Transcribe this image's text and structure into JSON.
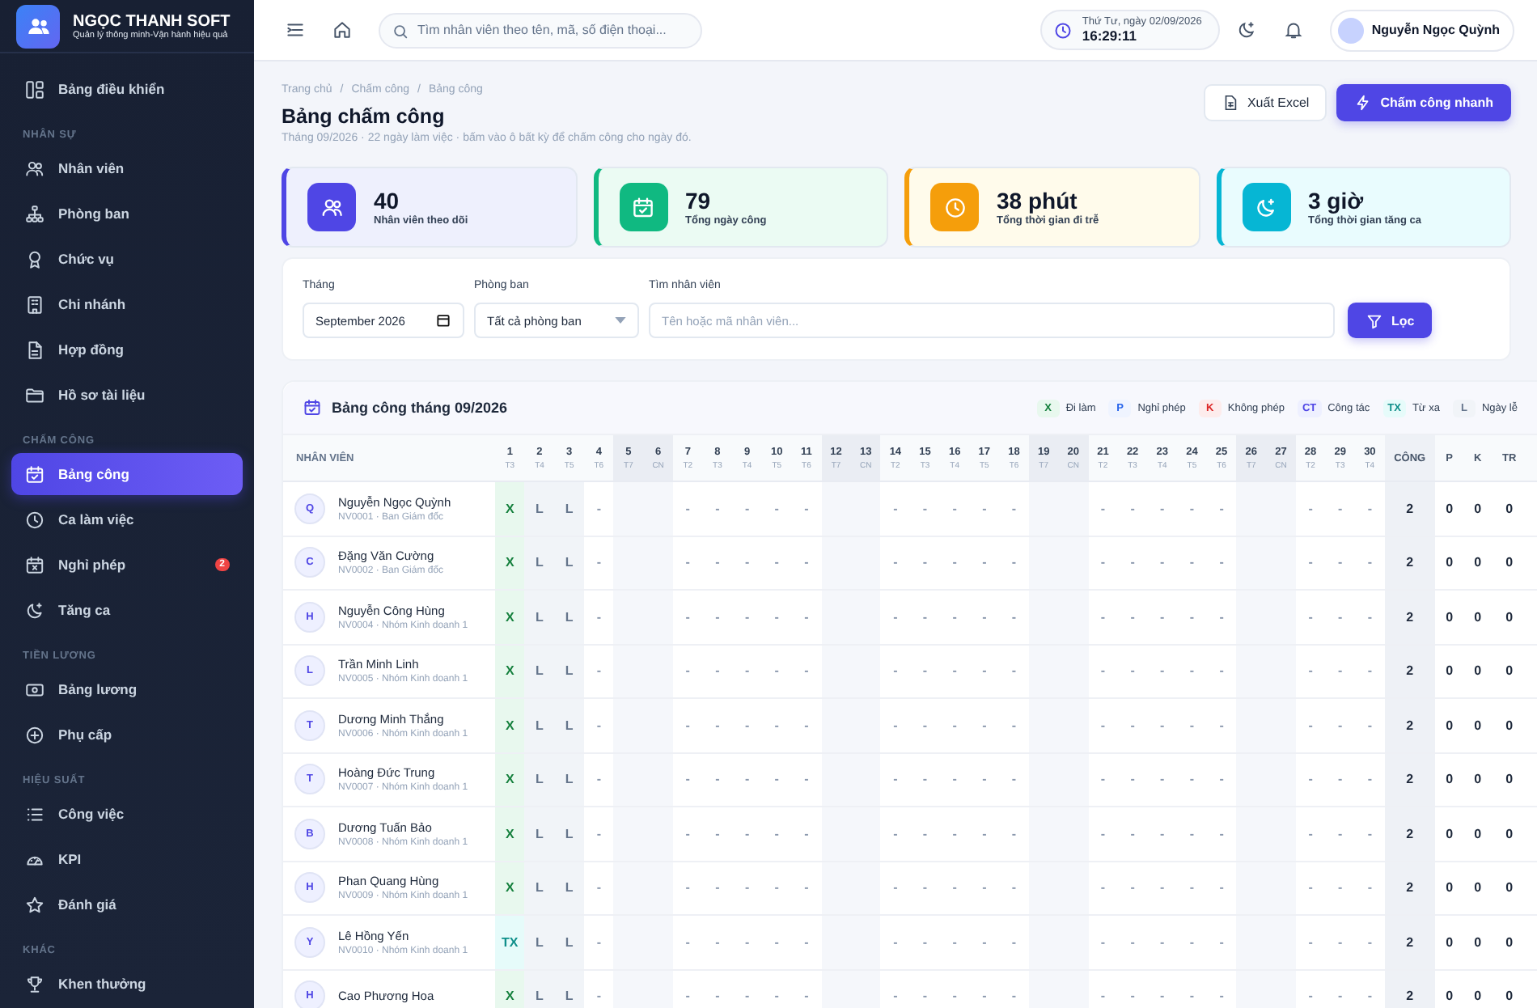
{
  "sidebar": {
    "brand": {
      "name": "NGỌC THANH SOFT",
      "tagline": "Quản lý thông minh-Vận hành hiệu quả"
    },
    "sections": [
      {
        "items": [
          {
            "label": "Bảng điều khiển",
            "selected": false
          }
        ]
      },
      {
        "title": "NHÂN SỰ",
        "items": [
          {
            "label": "Nhân viên",
            "selected": false
          },
          {
            "label": "Phòng ban",
            "selected": false
          },
          {
            "label": "Chức vụ",
            "selected": false
          },
          {
            "label": "Chi nhánh",
            "selected": false
          },
          {
            "label": "Hợp đồng",
            "selected": false
          },
          {
            "label": "Hồ sơ tài liệu",
            "selected": false
          }
        ]
      },
      {
        "title": "CHẤM CÔNG",
        "items": [
          {
            "label": "Bảng công",
            "selected": true
          },
          {
            "label": "Ca làm việc",
            "selected": false
          },
          {
            "label": "Nghỉ phép",
            "selected": false,
            "badge": "2"
          },
          {
            "label": "Tăng ca",
            "selected": false
          }
        ]
      },
      {
        "title": "TIỀN LƯƠNG",
        "items": [
          {
            "label": "Bảng lương",
            "selected": false
          },
          {
            "label": "Phụ cấp",
            "selected": false
          }
        ]
      },
      {
        "title": "HIỆU SUẤT",
        "items": [
          {
            "label": "Công việc",
            "selected": false
          },
          {
            "label": "KPI",
            "selected": false
          },
          {
            "label": "Đánh giá",
            "selected": false
          }
        ]
      },
      {
        "title": "KHÁC",
        "items": [
          {
            "label": "Khen thưởng",
            "selected": false
          }
        ]
      }
    ]
  },
  "topbar": {
    "search": {
      "placeholder": "Tìm nhân viên theo tên, mã, số điện thoại..."
    },
    "clock": {
      "date": "Thứ Tư, ngày 02/09/2026",
      "time": "16:29:11"
    },
    "user": {
      "name": "Nguyễn Ngọc Quỳnh"
    }
  },
  "breadcrumb": {
    "items": [
      "Trang chủ",
      "Chấm công",
      "Bảng công"
    ],
    "separator": "/"
  },
  "page": {
    "title": "Bảng chấm công",
    "subtitle": "Tháng 09/2026 · 22 ngày làm việc · bấm vào ô bất kỳ để chấm công cho ngày đó.",
    "buttons": [
      {
        "label": "Xuất Excel",
        "kind": "secondary"
      },
      {
        "label": "Chấm công nhanh",
        "kind": "primary"
      }
    ]
  },
  "stats": [
    {
      "value": "40",
      "label": "Nhân viên theo dõi",
      "color": "#4f46e5"
    },
    {
      "value": "79",
      "label": "Tổng ngày công",
      "color": "#10b981"
    },
    {
      "value": "38 phút",
      "label": "Tổng thời gian đi trễ",
      "color": "#f59e0b"
    },
    {
      "value": "3 giờ",
      "label": "Tổng thời gian tăng ca",
      "color": "#06b6d4"
    }
  ],
  "filters": {
    "month": {
      "label": "Tháng",
      "value": "September 2026"
    },
    "department": {
      "label": "Phòng ban",
      "value": "Tất cả phòng ban"
    },
    "search": {
      "label": "Tìm nhân viên",
      "placeholder": "Tên hoặc mã nhân viên..."
    },
    "button": "Lọc"
  },
  "table": {
    "title": "Bảng công tháng 09/2026",
    "legend": [
      {
        "code": "X",
        "label": "Đi làm",
        "kind": "present"
      },
      {
        "code": "P",
        "label": "Nghỉ phép",
        "kind": "leave"
      },
      {
        "code": "K",
        "label": "Không phép",
        "kind": "absent"
      },
      {
        "code": "CT",
        "label": "Công tác",
        "kind": "trip"
      },
      {
        "code": "TX",
        "label": "Từ xa",
        "kind": "remote"
      },
      {
        "code": "L",
        "label": "Ngày lễ",
        "kind": "holiday"
      }
    ],
    "name_column": "NHÂN VIÊN",
    "days": [
      {
        "day": "1",
        "weekday": "T3",
        "weekend": false
      },
      {
        "day": "2",
        "weekday": "T4",
        "weekend": false
      },
      {
        "day": "3",
        "weekday": "T5",
        "weekend": false
      },
      {
        "day": "4",
        "weekday": "T6",
        "weekend": false
      },
      {
        "day": "5",
        "weekday": "T7",
        "weekend": true
      },
      {
        "day": "6",
        "weekday": "CN",
        "weekend": true
      },
      {
        "day": "7",
        "weekday": "T2",
        "weekend": false
      },
      {
        "day": "8",
        "weekday": "T3",
        "weekend": false
      },
      {
        "day": "9",
        "weekday": "T4",
        "weekend": false
      },
      {
        "day": "10",
        "weekday": "T5",
        "weekend": false
      },
      {
        "day": "11",
        "weekday": "T6",
        "weekend": false
      },
      {
        "day": "12",
        "weekday": "T7",
        "weekend": true
      },
      {
        "day": "13",
        "weekday": "CN",
        "weekend": true
      },
      {
        "day": "14",
        "weekday": "T2",
        "weekend": false
      },
      {
        "day": "15",
        "weekday": "T3",
        "weekend": false
      },
      {
        "day": "16",
        "weekday": "T4",
        "weekend": false
      },
      {
        "day": "17",
        "weekday": "T5",
        "weekend": false
      },
      {
        "day": "18",
        "weekday": "T6",
        "weekend": false
      },
      {
        "day": "19",
        "weekday": "T7",
        "weekend": true
      },
      {
        "day": "20",
        "weekday": "CN",
        "weekend": true
      },
      {
        "day": "21",
        "weekday": "T2",
        "weekend": false
      },
      {
        "day": "22",
        "weekday": "T3",
        "weekend": false
      },
      {
        "day": "23",
        "weekday": "T4",
        "weekend": false
      },
      {
        "day": "24",
        "weekday": "T5",
        "weekend": false
      },
      {
        "day": "25",
        "weekday": "T6",
        "weekend": false
      },
      {
        "day": "26",
        "weekday": "T7",
        "weekend": true
      },
      {
        "day": "27",
        "weekday": "CN",
        "weekend": true
      },
      {
        "day": "28",
        "weekday": "T2",
        "weekend": false
      },
      {
        "day": "29",
        "weekday": "T3",
        "weekend": false
      },
      {
        "day": "30",
        "weekday": "T4",
        "weekend": false
      }
    ],
    "total_columns": [
      "CÔNG",
      "P",
      "K",
      "TR"
    ],
    "rows": [
      {
        "initial": "Q",
        "name": "Nguyễn Ngọc Quỳnh",
        "sub": "NV0001 · Ban Giám đốc",
        "cells": [
          {
            "text": "X",
            "kind": "present"
          },
          {
            "text": "L",
            "kind": "holiday"
          },
          {
            "text": "L",
            "kind": "holiday"
          },
          {
            "text": "-"
          },
          {},
          {},
          {
            "text": "-"
          },
          {
            "text": "-"
          },
          {
            "text": "-"
          },
          {
            "text": "-"
          },
          {
            "text": "-"
          },
          {},
          {},
          {
            "text": "-"
          },
          {
            "text": "-"
          },
          {
            "text": "-"
          },
          {
            "text": "-"
          },
          {
            "text": "-"
          },
          {},
          {},
          {
            "text": "-"
          },
          {
            "text": "-"
          },
          {
            "text": "-"
          },
          {
            "text": "-"
          },
          {
            "text": "-"
          },
          {},
          {},
          {
            "text": "-"
          },
          {
            "text": "-"
          },
          {
            "text": "-"
          }
        ],
        "totals": [
          "2",
          "0",
          "0",
          "0"
        ]
      },
      {
        "initial": "C",
        "name": "Đặng Văn Cường",
        "sub": "NV0002 · Ban Giám đốc",
        "cells": [
          {
            "text": "X",
            "kind": "present"
          },
          {
            "text": "L",
            "kind": "holiday"
          },
          {
            "text": "L",
            "kind": "holiday"
          },
          {
            "text": "-"
          },
          {},
          {},
          {
            "text": "-"
          },
          {
            "text": "-"
          },
          {
            "text": "-"
          },
          {
            "text": "-"
          },
          {
            "text": "-"
          },
          {},
          {},
          {
            "text": "-"
          },
          {
            "text": "-"
          },
          {
            "text": "-"
          },
          {
            "text": "-"
          },
          {
            "text": "-"
          },
          {},
          {},
          {
            "text": "-"
          },
          {
            "text": "-"
          },
          {
            "text": "-"
          },
          {
            "text": "-"
          },
          {
            "text": "-"
          },
          {},
          {},
          {
            "text": "-"
          },
          {
            "text": "-"
          },
          {
            "text": "-"
          }
        ],
        "totals": [
          "2",
          "0",
          "0",
          "0"
        ]
      },
      {
        "initial": "H",
        "name": "Nguyễn Công Hùng",
        "sub": "NV0004 · Nhóm Kinh doanh 1",
        "cells": [
          {
            "text": "X",
            "kind": "present"
          },
          {
            "text": "L",
            "kind": "holiday"
          },
          {
            "text": "L",
            "kind": "holiday"
          },
          {
            "text": "-"
          },
          {},
          {},
          {
            "text": "-"
          },
          {
            "text": "-"
          },
          {
            "text": "-"
          },
          {
            "text": "-"
          },
          {
            "text": "-"
          },
          {},
          {},
          {
            "text": "-"
          },
          {
            "text": "-"
          },
          {
            "text": "-"
          },
          {
            "text": "-"
          },
          {
            "text": "-"
          },
          {},
          {},
          {
            "text": "-"
          },
          {
            "text": "-"
          },
          {
            "text": "-"
          },
          {
            "text": "-"
          },
          {
            "text": "-"
          },
          {},
          {},
          {
            "text": "-"
          },
          {
            "text": "-"
          },
          {
            "text": "-"
          }
        ],
        "totals": [
          "2",
          "0",
          "0",
          "0"
        ]
      },
      {
        "initial": "L",
        "name": "Trần Minh Linh",
        "sub": "NV0005 · Nhóm Kinh doanh 1",
        "cells": [
          {
            "text": "X",
            "kind": "present"
          },
          {
            "text": "L",
            "kind": "holiday"
          },
          {
            "text": "L",
            "kind": "holiday"
          },
          {
            "text": "-"
          },
          {},
          {},
          {
            "text": "-"
          },
          {
            "text": "-"
          },
          {
            "text": "-"
          },
          {
            "text": "-"
          },
          {
            "text": "-"
          },
          {},
          {},
          {
            "text": "-"
          },
          {
            "text": "-"
          },
          {
            "text": "-"
          },
          {
            "text": "-"
          },
          {
            "text": "-"
          },
          {},
          {},
          {
            "text": "-"
          },
          {
            "text": "-"
          },
          {
            "text": "-"
          },
          {
            "text": "-"
          },
          {
            "text": "-"
          },
          {},
          {},
          {
            "text": "-"
          },
          {
            "text": "-"
          },
          {
            "text": "-"
          }
        ],
        "totals": [
          "2",
          "0",
          "0",
          "0"
        ]
      },
      {
        "initial": "T",
        "name": "Dương Minh Thắng",
        "sub": "NV0006 · Nhóm Kinh doanh 1",
        "cells": [
          {
            "text": "X",
            "kind": "present"
          },
          {
            "text": "L",
            "kind": "holiday"
          },
          {
            "text": "L",
            "kind": "holiday"
          },
          {
            "text": "-"
          },
          {},
          {},
          {
            "text": "-"
          },
          {
            "text": "-"
          },
          {
            "text": "-"
          },
          {
            "text": "-"
          },
          {
            "text": "-"
          },
          {},
          {},
          {
            "text": "-"
          },
          {
            "text": "-"
          },
          {
            "text": "-"
          },
          {
            "text": "-"
          },
          {
            "text": "-"
          },
          {},
          {},
          {
            "text": "-"
          },
          {
            "text": "-"
          },
          {
            "text": "-"
          },
          {
            "text": "-"
          },
          {
            "text": "-"
          },
          {},
          {},
          {
            "text": "-"
          },
          {
            "text": "-"
          },
          {
            "text": "-"
          }
        ],
        "totals": [
          "2",
          "0",
          "0",
          "0"
        ]
      },
      {
        "initial": "T",
        "name": "Hoàng Đức Trung",
        "sub": "NV0007 · Nhóm Kinh doanh 1",
        "cells": [
          {
            "text": "X",
            "kind": "present"
          },
          {
            "text": "L",
            "kind": "holiday"
          },
          {
            "text": "L",
            "kind": "holiday"
          },
          {
            "text": "-"
          },
          {},
          {},
          {
            "text": "-"
          },
          {
            "text": "-"
          },
          {
            "text": "-"
          },
          {
            "text": "-"
          },
          {
            "text": "-"
          },
          {},
          {},
          {
            "text": "-"
          },
          {
            "text": "-"
          },
          {
            "text": "-"
          },
          {
            "text": "-"
          },
          {
            "text": "-"
          },
          {},
          {},
          {
            "text": "-"
          },
          {
            "text": "-"
          },
          {
            "text": "-"
          },
          {
            "text": "-"
          },
          {
            "text": "-"
          },
          {},
          {},
          {
            "text": "-"
          },
          {
            "text": "-"
          },
          {
            "text": "-"
          }
        ],
        "totals": [
          "2",
          "0",
          "0",
          "0"
        ]
      },
      {
        "initial": "B",
        "name": "Dương Tuấn Bảo",
        "sub": "NV0008 · Nhóm Kinh doanh 1",
        "cells": [
          {
            "text": "X",
            "kind": "present"
          },
          {
            "text": "L",
            "kind": "holiday"
          },
          {
            "text": "L",
            "kind": "holiday"
          },
          {
            "text": "-"
          },
          {},
          {},
          {
            "text": "-"
          },
          {
            "text": "-"
          },
          {
            "text": "-"
          },
          {
            "text": "-"
          },
          {
            "text": "-"
          },
          {},
          {},
          {
            "text": "-"
          },
          {
            "text": "-"
          },
          {
            "text": "-"
          },
          {
            "text": "-"
          },
          {
            "text": "-"
          },
          {},
          {},
          {
            "text": "-"
          },
          {
            "text": "-"
          },
          {
            "text": "-"
          },
          {
            "text": "-"
          },
          {
            "text": "-"
          },
          {},
          {},
          {
            "text": "-"
          },
          {
            "text": "-"
          },
          {
            "text": "-"
          }
        ],
        "totals": [
          "2",
          "0",
          "0",
          "0"
        ]
      },
      {
        "initial": "H",
        "name": "Phan Quang Hùng",
        "sub": "NV0009 · Nhóm Kinh doanh 1",
        "cells": [
          {
            "text": "X",
            "kind": "present"
          },
          {
            "text": "L",
            "kind": "holiday"
          },
          {
            "text": "L",
            "kind": "holiday"
          },
          {
            "text": "-"
          },
          {},
          {},
          {
            "text": "-"
          },
          {
            "text": "-"
          },
          {
            "text": "-"
          },
          {
            "text": "-"
          },
          {
            "text": "-"
          },
          {},
          {},
          {
            "text": "-"
          },
          {
            "text": "-"
          },
          {
            "text": "-"
          },
          {
            "text": "-"
          },
          {
            "text": "-"
          },
          {},
          {},
          {
            "text": "-"
          },
          {
            "text": "-"
          },
          {
            "text": "-"
          },
          {
            "text": "-"
          },
          {
            "text": "-"
          },
          {},
          {},
          {
            "text": "-"
          },
          {
            "text": "-"
          },
          {
            "text": "-"
          }
        ],
        "totals": [
          "2",
          "0",
          "0",
          "0"
        ]
      },
      {
        "initial": "Y",
        "name": "Lê Hồng Yến",
        "sub": "NV0010 · Nhóm Kinh doanh 1",
        "cells": [
          {
            "text": "TX",
            "kind": "remote"
          },
          {
            "text": "L",
            "kind": "holiday"
          },
          {
            "text": "L",
            "kind": "holiday"
          },
          {
            "text": "-"
          },
          {},
          {},
          {
            "text": "-"
          },
          {
            "text": "-"
          },
          {
            "text": "-"
          },
          {
            "text": "-"
          },
          {
            "text": "-"
          },
          {},
          {},
          {
            "text": "-"
          },
          {
            "text": "-"
          },
          {
            "text": "-"
          },
          {
            "text": "-"
          },
          {
            "text": "-"
          },
          {},
          {},
          {
            "text": "-"
          },
          {
            "text": "-"
          },
          {
            "text": "-"
          },
          {
            "text": "-"
          },
          {
            "text": "-"
          },
          {},
          {},
          {
            "text": "-"
          },
          {
            "text": "-"
          },
          {
            "text": "-"
          }
        ],
        "totals": [
          "2",
          "0",
          "0",
          "0"
        ]
      },
      {
        "initial": "H",
        "name": "Cao Phương Hoa",
        "cells": [
          {
            "text": "X",
            "kind": "present"
          },
          {
            "text": "L",
            "kind": "holiday"
          },
          {
            "text": "L",
            "kind": "holiday"
          },
          {
            "text": "-"
          },
          {},
          {},
          {
            "text": "-"
          },
          {
            "text": "-"
          },
          {
            "text": "-"
          },
          {
            "text": "-"
          },
          {
            "text": "-"
          },
          {},
          {},
          {
            "text": "-"
          },
          {
            "text": "-"
          },
          {
            "text": "-"
          },
          {
            "text": "-"
          },
          {
            "text": "-"
          },
          {},
          {},
          {
            "text": "-"
          },
          {
            "text": "-"
          },
          {
            "text": "-"
          },
          {
            "text": "-"
          },
          {
            "text": "-"
          },
          {},
          {},
          {
            "text": "-"
          },
          {
            "text": "-"
          },
          {
            "text": "-"
          }
        ],
        "totals": [
          "2",
          "0",
          "0",
          "0"
        ]
      }
    ]
  }
}
